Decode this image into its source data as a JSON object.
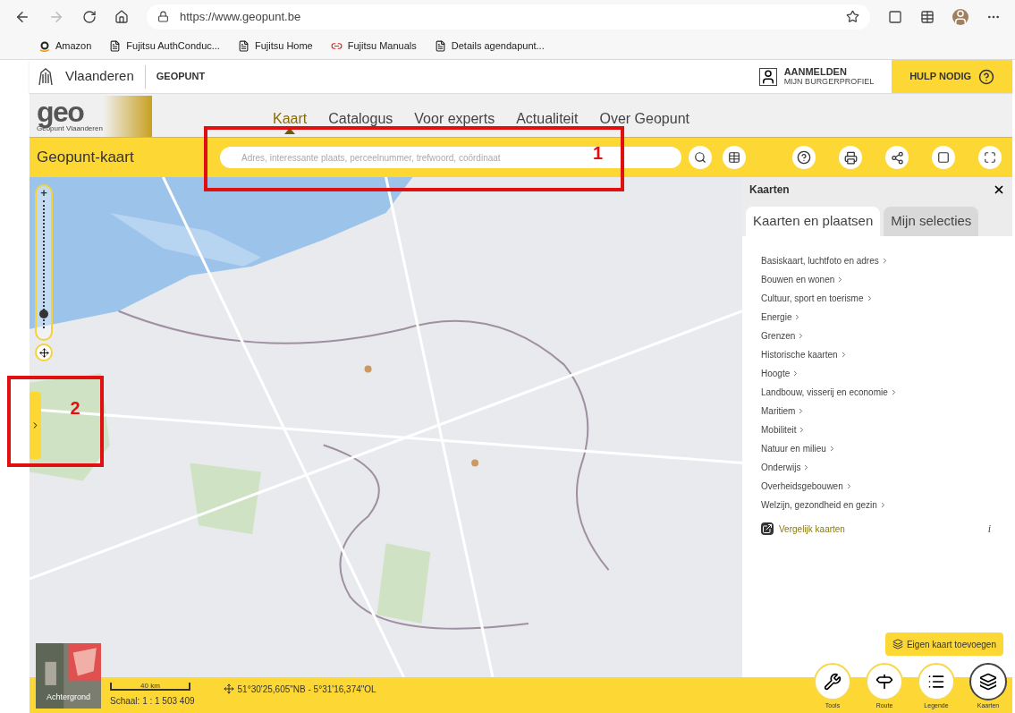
{
  "browser": {
    "url": "https://www.geopunt.be",
    "bookmarks": [
      {
        "label": "Amazon",
        "kind": "amazon"
      },
      {
        "label": "Fujitsu AuthConduc...",
        "kind": "page"
      },
      {
        "label": "Fujitsu Home",
        "kind": "page"
      },
      {
        "label": "Fujitsu Manuals",
        "kind": "link"
      },
      {
        "label": "Details agendapunt...",
        "kind": "page"
      }
    ]
  },
  "header": {
    "brand": "Vlaanderen",
    "section": "GEOPUNT",
    "login": "AANMELDEN",
    "login_sub": "MIJN BURGERPROFIEL",
    "help": "HULP NODIG"
  },
  "logo": {
    "mark": "geo",
    "sub": "Geopunt Vlaanderen"
  },
  "nav": [
    {
      "label": "Kaart",
      "selected": true
    },
    {
      "label": "Catalogus",
      "selected": false
    },
    {
      "label": "Voor experts",
      "selected": false
    },
    {
      "label": "Actualiteit",
      "selected": false
    },
    {
      "label": "Over Geopunt",
      "selected": false
    }
  ],
  "toolbar": {
    "title": "Geopunt-kaart",
    "search_placeholder": "Adres, interessante plaats, perceelnummer, trefwoord, coördinaat"
  },
  "zoom": {
    "plus": "+",
    "level": 0.08
  },
  "annotations": [
    {
      "label": "1"
    },
    {
      "label": "2"
    }
  ],
  "panel": {
    "title": "Kaarten",
    "tabs": [
      {
        "label": "Kaarten en plaatsen",
        "selected": true
      },
      {
        "label": "Mijn selecties",
        "selected": false
      }
    ],
    "items": [
      "Basiskaart, luchtfoto en adres",
      "Bouwen en wonen",
      "Cultuur, sport en toerisme",
      "Energie",
      "Grenzen",
      "Historische kaarten",
      "Hoogte",
      "Landbouw, visserij en economie",
      "Maritiem",
      "Mobiliteit",
      "Natuur en milieu",
      "Onderwijs",
      "Overheidsgebouwen",
      "Welzijn, gezondheid en gezin"
    ],
    "compare": "Vergelijk kaarten",
    "info": "i",
    "add": "Eigen kaart toevoegen"
  },
  "footer": {
    "background": "Achtergrond",
    "scale_bar": "40 km",
    "scale": "Schaal: 1 : 1 503 409",
    "coords": "51°30'25,605\"NB - 5°31'16,374\"OL",
    "tools": [
      {
        "label": "Tools",
        "kind": "wrench",
        "selected": false
      },
      {
        "label": "Route",
        "kind": "route",
        "selected": false
      },
      {
        "label": "Legende",
        "kind": "list",
        "selected": false
      },
      {
        "label": "Kaarten",
        "kind": "layers",
        "selected": true
      }
    ]
  }
}
